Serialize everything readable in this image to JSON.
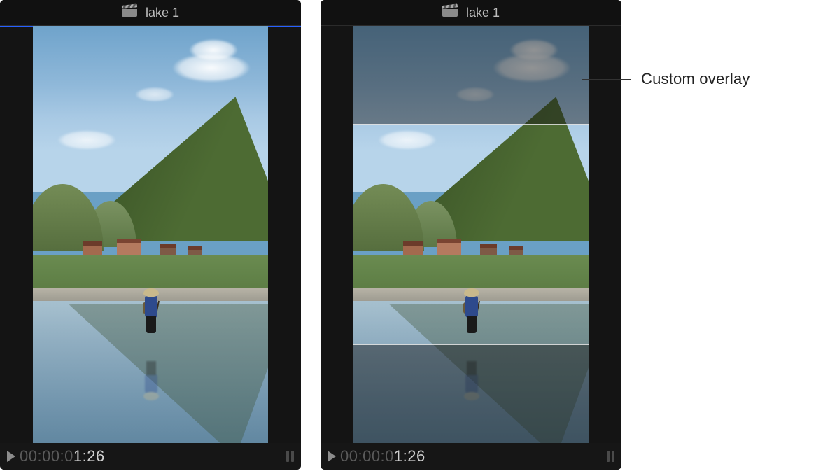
{
  "clip_name": "lake 1",
  "playhead": {
    "prefix": "00:00:0",
    "emph": "1:26"
  },
  "callouts": {
    "custom_overlay": "Custom overlay"
  },
  "icons": {
    "clip": "clapperboard-icon",
    "play": "play-icon",
    "loop": "loop-icon"
  }
}
